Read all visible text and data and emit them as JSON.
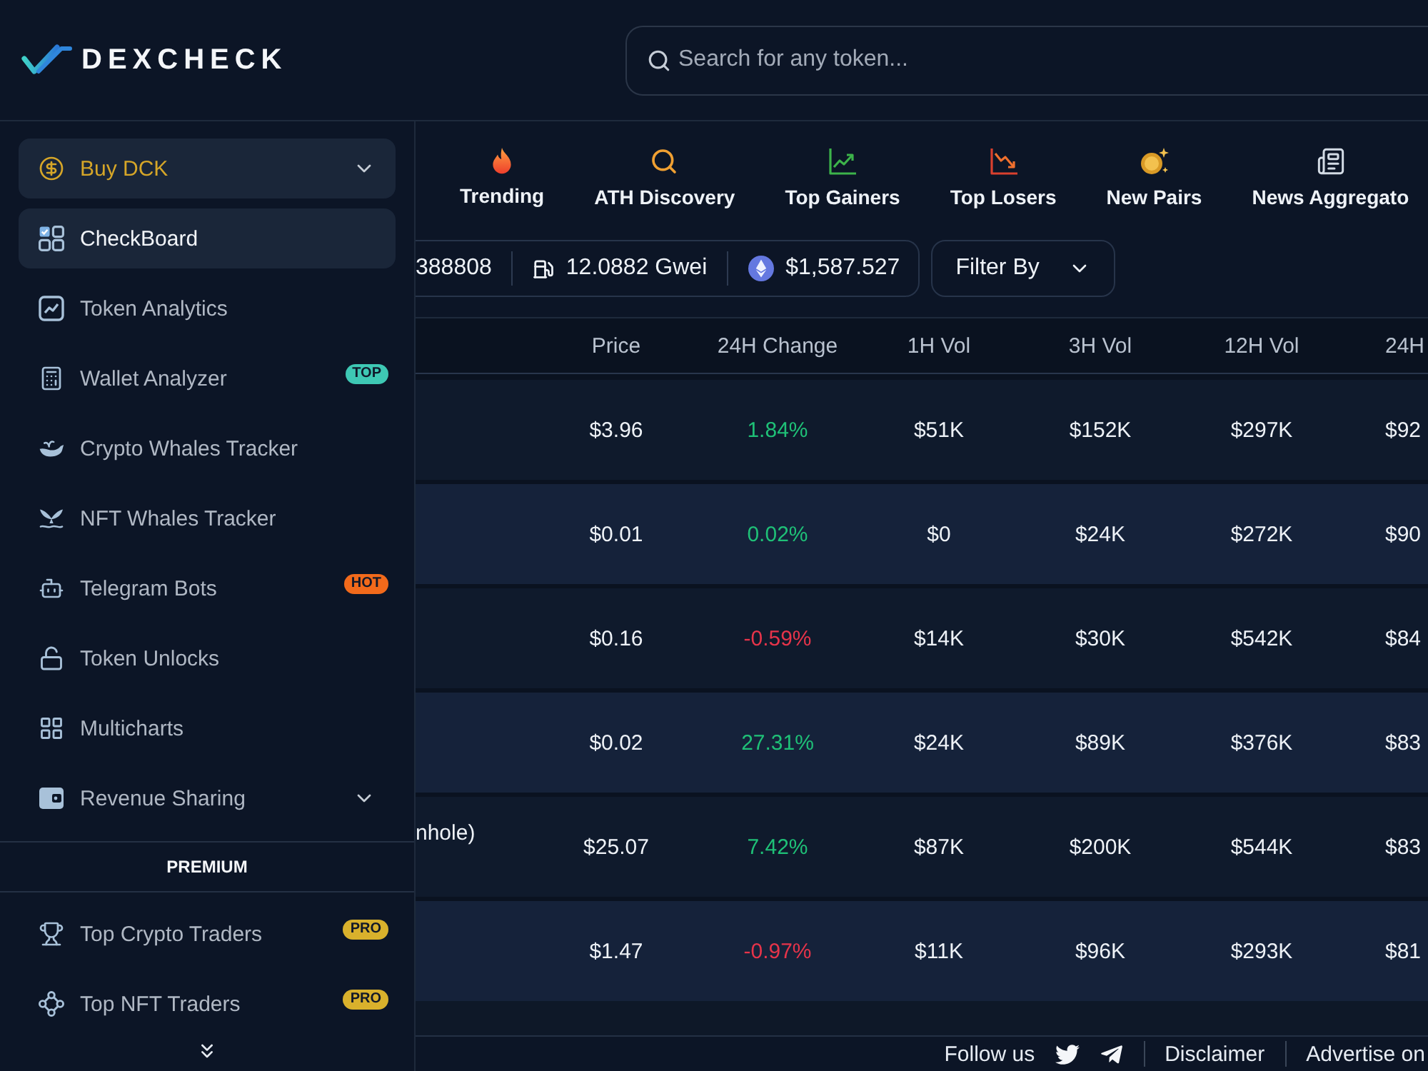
{
  "header": {
    "logo_text": "DEXCHECK",
    "search": {
      "placeholder": "Search for any token..."
    }
  },
  "sidebar": {
    "items": [
      {
        "label": "Buy DCK",
        "kind": "buy",
        "selected": false,
        "expanded": false
      },
      {
        "label": "CheckBoard",
        "kind": "link",
        "selected": true
      },
      {
        "label": "Token Analytics",
        "kind": "link",
        "selected": false
      },
      {
        "label": "Wallet Analyzer",
        "kind": "link",
        "selected": false,
        "badge": {
          "text": "TOP",
          "color": "#3ec8b4"
        }
      },
      {
        "label": "Crypto Whales Tracker",
        "kind": "link",
        "selected": false
      },
      {
        "label": "NFT Whales Tracker",
        "kind": "link",
        "selected": false
      },
      {
        "label": "Telegram Bots",
        "kind": "link",
        "selected": false,
        "badge": {
          "text": "HOT",
          "color": "#f26a1b"
        }
      },
      {
        "label": "Token Unlocks",
        "kind": "link",
        "selected": false
      },
      {
        "label": "Multicharts",
        "kind": "link",
        "selected": false
      },
      {
        "label": "Revenue Sharing",
        "kind": "link",
        "selected": false,
        "expanded": false
      }
    ],
    "premium_heading": "PREMIUM",
    "premium_items": [
      {
        "label": "Top Crypto Traders",
        "kind": "link",
        "selected": false,
        "badge": {
          "text": "PRO",
          "color": "#d9b12c"
        }
      },
      {
        "label": "Top NFT Traders",
        "kind": "link",
        "selected": false,
        "badge": {
          "text": "PRO",
          "color": "#d9b12c"
        }
      }
    ]
  },
  "tabs": [
    {
      "label": "Trending",
      "selected": false
    },
    {
      "label": "ATH Discovery",
      "selected": false
    },
    {
      "label": "Top Gainers",
      "selected": false
    },
    {
      "label": "Top Losers",
      "selected": false
    },
    {
      "label": "New Pairs",
      "selected": false
    },
    {
      "label": "News Aggregato",
      "selected": false
    }
  ],
  "stats": [
    {
      "text": "388808"
    },
    {
      "text": "12.0882 Gwei"
    },
    {
      "text": "$1,587.527"
    }
  ],
  "filter": {
    "label": "Filter By"
  },
  "table": {
    "columns": [
      "Price",
      "24H Change",
      "1H Vol",
      "3H Vol",
      "12H Vol",
      "24H"
    ],
    "rows": [
      {
        "cells": [
          "$3.96",
          "1.84%",
          "$51K",
          "$152K",
          "$297K",
          "$92"
        ],
        "positive": true
      },
      {
        "cells": [
          "$0.01",
          "0.02%",
          "$0",
          "$24K",
          "$272K",
          "$90"
        ],
        "positive": true
      },
      {
        "cells": [
          "$0.16",
          "-0.59%",
          "$14K",
          "$30K",
          "$542K",
          "$84"
        ],
        "positive": false
      },
      {
        "cells": [
          "$0.02",
          "27.31%",
          "$24K",
          "$89K",
          "$376K",
          "$83"
        ],
        "positive": true
      },
      {
        "column_1": "nhole)",
        "cells": [
          "$25.07",
          "7.42%",
          "$87K",
          "$200K",
          "$544K",
          "$83"
        ],
        "positive": true
      },
      {
        "cells": [
          "$1.47",
          "-0.97%",
          "$11K",
          "$96K",
          "$293K",
          "$81"
        ],
        "positive": false
      }
    ]
  },
  "footer": {
    "follow_label": "Follow us",
    "links": [
      "Disclaimer",
      "Advertise on"
    ]
  }
}
